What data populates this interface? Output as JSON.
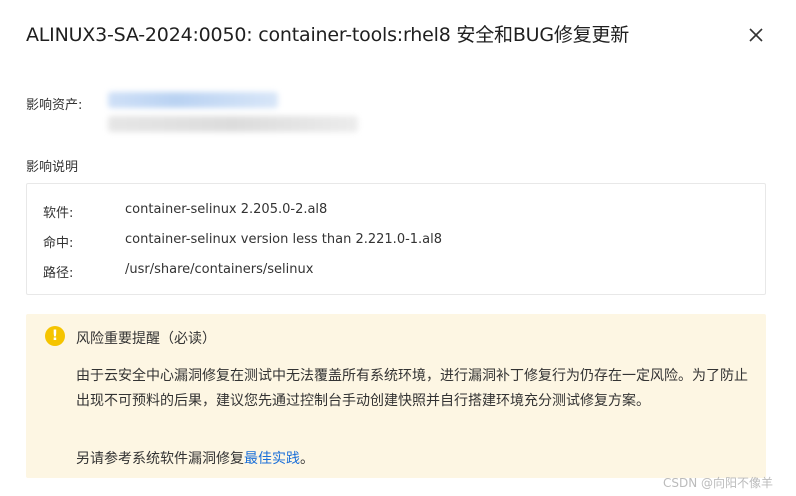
{
  "dialog": {
    "title": "ALINUX3-SA-2024:0050: container-tools:rhel8 安全和BUG修复更新",
    "close_icon": "close-icon"
  },
  "affected_assets": {
    "label": "影响资产:"
  },
  "impact": {
    "label": "影响说明",
    "rows": [
      {
        "key": "软件:",
        "value": "container-selinux 2.205.0-2.al8"
      },
      {
        "key": "命中:",
        "value": "container-selinux version less than 2.221.0-1.al8"
      },
      {
        "key": "路径:",
        "value": "/usr/share/containers/selinux"
      }
    ]
  },
  "warning": {
    "icon": "exclamation-icon",
    "title": "风险重要提醒（必读）",
    "body": "由于云安全中心漏洞修复在测试中无法覆盖所有系统环境，进行漏洞补丁修复行为仍存在一定风险。为了防止出现不可预料的后果，建议您先通过控制台手动创建快照并自行搭建环境充分测试修复方案。",
    "footer_prefix": "另请参考系统软件漏洞修复",
    "footer_link": "最佳实践",
    "footer_suffix": "。",
    "background": "#fdf6e3",
    "icon_color": "#f5c400"
  },
  "watermark": "CSDN @向阳不像羊"
}
